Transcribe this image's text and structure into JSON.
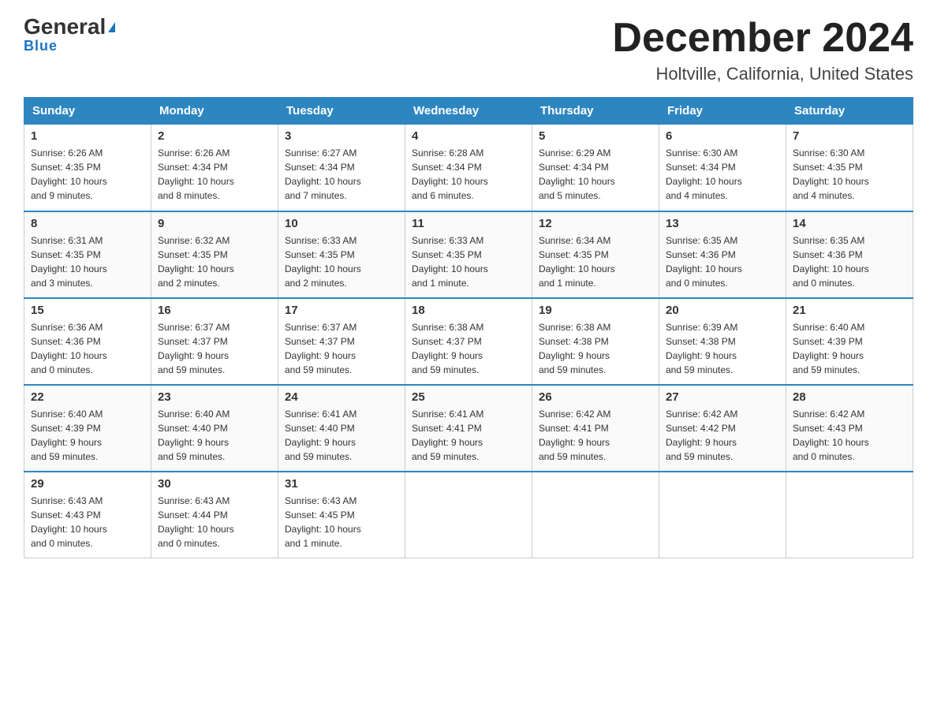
{
  "header": {
    "logo_main": "General",
    "logo_sub": "Blue",
    "month": "December 2024",
    "location": "Holtville, California, United States"
  },
  "weekdays": [
    "Sunday",
    "Monday",
    "Tuesday",
    "Wednesday",
    "Thursday",
    "Friday",
    "Saturday"
  ],
  "weeks": [
    [
      {
        "day": "1",
        "info": "Sunrise: 6:26 AM\nSunset: 4:35 PM\nDaylight: 10 hours\nand 9 minutes."
      },
      {
        "day": "2",
        "info": "Sunrise: 6:26 AM\nSunset: 4:34 PM\nDaylight: 10 hours\nand 8 minutes."
      },
      {
        "day": "3",
        "info": "Sunrise: 6:27 AM\nSunset: 4:34 PM\nDaylight: 10 hours\nand 7 minutes."
      },
      {
        "day": "4",
        "info": "Sunrise: 6:28 AM\nSunset: 4:34 PM\nDaylight: 10 hours\nand 6 minutes."
      },
      {
        "day": "5",
        "info": "Sunrise: 6:29 AM\nSunset: 4:34 PM\nDaylight: 10 hours\nand 5 minutes."
      },
      {
        "day": "6",
        "info": "Sunrise: 6:30 AM\nSunset: 4:34 PM\nDaylight: 10 hours\nand 4 minutes."
      },
      {
        "day": "7",
        "info": "Sunrise: 6:30 AM\nSunset: 4:35 PM\nDaylight: 10 hours\nand 4 minutes."
      }
    ],
    [
      {
        "day": "8",
        "info": "Sunrise: 6:31 AM\nSunset: 4:35 PM\nDaylight: 10 hours\nand 3 minutes."
      },
      {
        "day": "9",
        "info": "Sunrise: 6:32 AM\nSunset: 4:35 PM\nDaylight: 10 hours\nand 2 minutes."
      },
      {
        "day": "10",
        "info": "Sunrise: 6:33 AM\nSunset: 4:35 PM\nDaylight: 10 hours\nand 2 minutes."
      },
      {
        "day": "11",
        "info": "Sunrise: 6:33 AM\nSunset: 4:35 PM\nDaylight: 10 hours\nand 1 minute."
      },
      {
        "day": "12",
        "info": "Sunrise: 6:34 AM\nSunset: 4:35 PM\nDaylight: 10 hours\nand 1 minute."
      },
      {
        "day": "13",
        "info": "Sunrise: 6:35 AM\nSunset: 4:36 PM\nDaylight: 10 hours\nand 0 minutes."
      },
      {
        "day": "14",
        "info": "Sunrise: 6:35 AM\nSunset: 4:36 PM\nDaylight: 10 hours\nand 0 minutes."
      }
    ],
    [
      {
        "day": "15",
        "info": "Sunrise: 6:36 AM\nSunset: 4:36 PM\nDaylight: 10 hours\nand 0 minutes."
      },
      {
        "day": "16",
        "info": "Sunrise: 6:37 AM\nSunset: 4:37 PM\nDaylight: 9 hours\nand 59 minutes."
      },
      {
        "day": "17",
        "info": "Sunrise: 6:37 AM\nSunset: 4:37 PM\nDaylight: 9 hours\nand 59 minutes."
      },
      {
        "day": "18",
        "info": "Sunrise: 6:38 AM\nSunset: 4:37 PM\nDaylight: 9 hours\nand 59 minutes."
      },
      {
        "day": "19",
        "info": "Sunrise: 6:38 AM\nSunset: 4:38 PM\nDaylight: 9 hours\nand 59 minutes."
      },
      {
        "day": "20",
        "info": "Sunrise: 6:39 AM\nSunset: 4:38 PM\nDaylight: 9 hours\nand 59 minutes."
      },
      {
        "day": "21",
        "info": "Sunrise: 6:40 AM\nSunset: 4:39 PM\nDaylight: 9 hours\nand 59 minutes."
      }
    ],
    [
      {
        "day": "22",
        "info": "Sunrise: 6:40 AM\nSunset: 4:39 PM\nDaylight: 9 hours\nand 59 minutes."
      },
      {
        "day": "23",
        "info": "Sunrise: 6:40 AM\nSunset: 4:40 PM\nDaylight: 9 hours\nand 59 minutes."
      },
      {
        "day": "24",
        "info": "Sunrise: 6:41 AM\nSunset: 4:40 PM\nDaylight: 9 hours\nand 59 minutes."
      },
      {
        "day": "25",
        "info": "Sunrise: 6:41 AM\nSunset: 4:41 PM\nDaylight: 9 hours\nand 59 minutes."
      },
      {
        "day": "26",
        "info": "Sunrise: 6:42 AM\nSunset: 4:41 PM\nDaylight: 9 hours\nand 59 minutes."
      },
      {
        "day": "27",
        "info": "Sunrise: 6:42 AM\nSunset: 4:42 PM\nDaylight: 9 hours\nand 59 minutes."
      },
      {
        "day": "28",
        "info": "Sunrise: 6:42 AM\nSunset: 4:43 PM\nDaylight: 10 hours\nand 0 minutes."
      }
    ],
    [
      {
        "day": "29",
        "info": "Sunrise: 6:43 AM\nSunset: 4:43 PM\nDaylight: 10 hours\nand 0 minutes."
      },
      {
        "day": "30",
        "info": "Sunrise: 6:43 AM\nSunset: 4:44 PM\nDaylight: 10 hours\nand 0 minutes."
      },
      {
        "day": "31",
        "info": "Sunrise: 6:43 AM\nSunset: 4:45 PM\nDaylight: 10 hours\nand 1 minute."
      },
      {
        "day": "",
        "info": ""
      },
      {
        "day": "",
        "info": ""
      },
      {
        "day": "",
        "info": ""
      },
      {
        "day": "",
        "info": ""
      }
    ]
  ]
}
